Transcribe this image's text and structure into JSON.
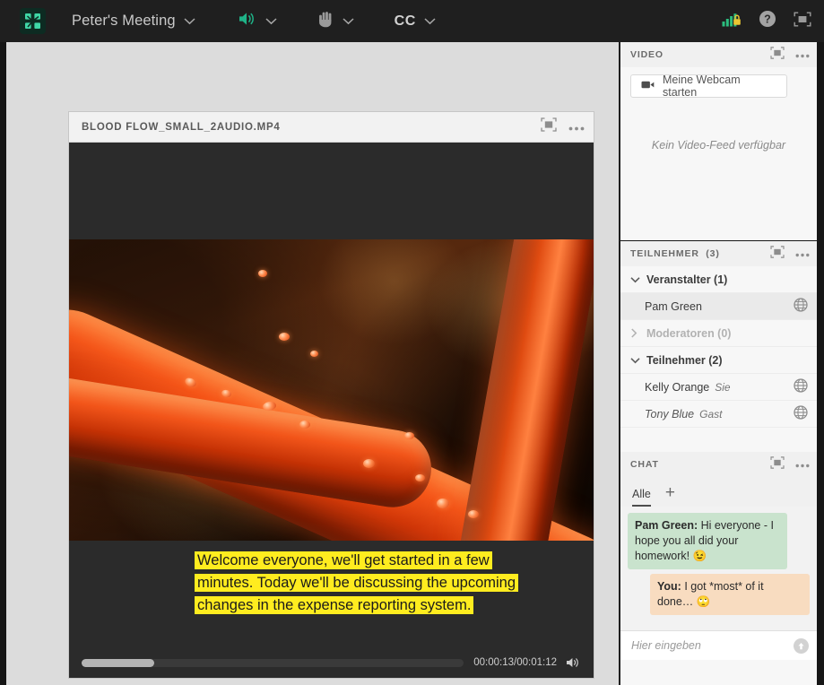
{
  "topbar": {
    "logo_icon": "adobe-connect-logo",
    "meeting_title": "Peter's Meeting",
    "title_caret_icon": "chevron-down-icon",
    "audio_icon": "speaker-on-icon",
    "audio_caret_icon": "chevron-down-icon",
    "hand_icon": "raise-hand-icon",
    "hand_caret_icon": "chevron-down-icon",
    "cc_label": "CC",
    "cc_caret_icon": "chevron-down-icon",
    "connection_icon": "connection-secure-icon",
    "help_icon": "help-circle-icon",
    "fullscreen_icon": "fullscreen-icon",
    "accent_green": "#1fb287",
    "bar_bg": "#1f1f1f"
  },
  "share_pod": {
    "title": "BLOOD FLOW_SMALL_2AUDIO.MP4",
    "expand_icon": "expand-pod-icon",
    "menu_icon": "pod-menu-icon",
    "caption_text": "Welcome everyone, we'll get started in a few minutes. Today we'll be discussing the upcoming changes in the expense reporting system.",
    "caption_highlight_color": "#ffec1f",
    "timecode": "00:00:13/00:01:12",
    "progress_percent": 19,
    "volume_icon": "volume-on-icon"
  },
  "video_panel": {
    "title": "VIDEO",
    "expand_icon": "expand-pod-icon",
    "menu_icon": "pod-menu-icon",
    "start_webcam_label": "Meine Webcam starten",
    "webcam_icon": "camera-icon",
    "empty_state": "Kein Video-Feed verfügbar"
  },
  "participants_panel": {
    "title": "TEILNEHMER",
    "count_label": "(3)",
    "expand_icon": "expand-pod-icon",
    "menu_icon": "pod-menu-icon",
    "groups": [
      {
        "label": "Veranstalter (1)",
        "chevron_icon": "chevron-down-icon",
        "expanded": true,
        "dim": false,
        "people": [
          {
            "name": "Pam Green",
            "tag": "",
            "status_icon": "globe-icon",
            "selected": true,
            "guest": false
          }
        ]
      },
      {
        "label": "Moderatoren (0)",
        "chevron_icon": "chevron-right-icon",
        "expanded": false,
        "dim": true,
        "people": []
      },
      {
        "label": "Teilnehmer (2)",
        "chevron_icon": "chevron-down-icon",
        "expanded": true,
        "dim": false,
        "people": [
          {
            "name": "Kelly Orange",
            "tag": "Sie",
            "status_icon": "globe-icon",
            "selected": false,
            "guest": false
          },
          {
            "name": "Tony Blue",
            "tag": "Gast",
            "status_icon": "globe-icon",
            "selected": false,
            "guest": true
          }
        ]
      }
    ]
  },
  "chat_panel": {
    "title": "CHAT",
    "expand_icon": "expand-pod-icon",
    "menu_icon": "pod-menu-icon",
    "tab_label": "Alle",
    "add_tab_icon": "plus-icon",
    "messages": [
      {
        "sender": "Pam Green:",
        "text": " Hi everyone - I hope you all did your homework! 😉",
        "direction": "inbound",
        "color": "#c9e3cd"
      },
      {
        "sender": "You:",
        "text": " I got *most* of it done… 🙄",
        "direction": "outbound",
        "color": "#f8dcc0"
      }
    ],
    "input_placeholder": "Hier eingeben",
    "send_icon": "send-up-icon"
  }
}
